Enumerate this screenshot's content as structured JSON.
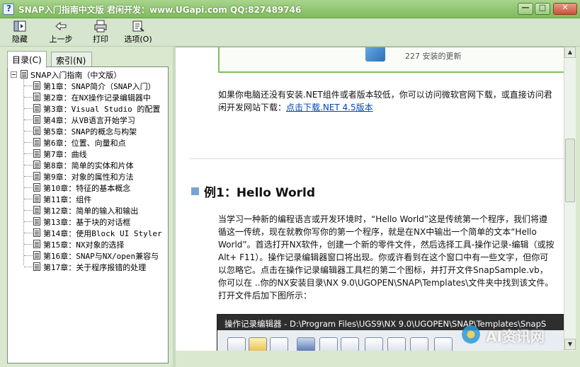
{
  "window": {
    "title": "SNAP入门指南中文版   君闲开发：www.UGapi.com  QQ:827489746",
    "controls": [
      "—",
      "□",
      "✕"
    ]
  },
  "toolbar": {
    "hide": "隐藏",
    "back": "上一步",
    "print": "打印",
    "options": "选项(O)"
  },
  "sidebar": {
    "tabs": [
      "目录(C)",
      "索引(N)"
    ],
    "root": "SNAP入门指南（中文版）",
    "items": [
      "第1章：SNAP简介（SNAP入门）",
      "第2章：在NX操作记录编辑器中",
      "第3章：Visual Studio 的配置",
      "第4章：从VB语言开始学习",
      "第5章：SNAP的概念与构架",
      "第6章：位置、向量和点",
      "第7章：曲线",
      "第8章：简单的实体和片体",
      "第9章：对象的属性和方法",
      "第10章：特征的基本概念",
      "第11章：组件",
      "第12章：简单的输入和输出",
      "第13章：基于块的对话框",
      "第14章：使用Block UI Styler",
      "第15章：NX对象的选择",
      "第16章：SNAP与NX/open兼容与",
      "第17章：关于程序报错的处理"
    ]
  },
  "content": {
    "update_label": "227 安装的更新",
    "para1": "如果你电脑还没有安装.NET组件或者版本较低，你可以访问微软官网下载，或直接访问君闲开发网站下载：",
    "download_link": "点击下载.NET 4.5版本",
    "heading": "例1：Hello World",
    "para2": "当学习一种新的编程语言或开发环境时，“Hello World”这是传统第一个程序，我们将遵循这一传统，现在就教你写你的第一个程序，就是在NX中输出一个简单的文本“Hello World”。首选打开NX软件，创建一个新的零件文件，然后选择工具-操作记录-编辑（或按Alt+ F11）。操作记录编辑器窗口将出现。你或许看到在这个窗口中有一些文字，但你可以忽略它。点击在操作记录编辑器工具栏的第二个图标，并打开文件SnapSample.vb，你可以在 ..你的NX安装目录\\NX 9.0\\UGOPEN\\SNAP\\Templates\\文件夹中找到该文件。打开文件后加下图所示：",
    "editor_title": "操作记录编辑器 - D:\\Program Files\\UGS9\\NX 9.0\\UGOPEN\\SNAP\\Templates\\SnapS"
  },
  "watermark": "AI资讯网"
}
